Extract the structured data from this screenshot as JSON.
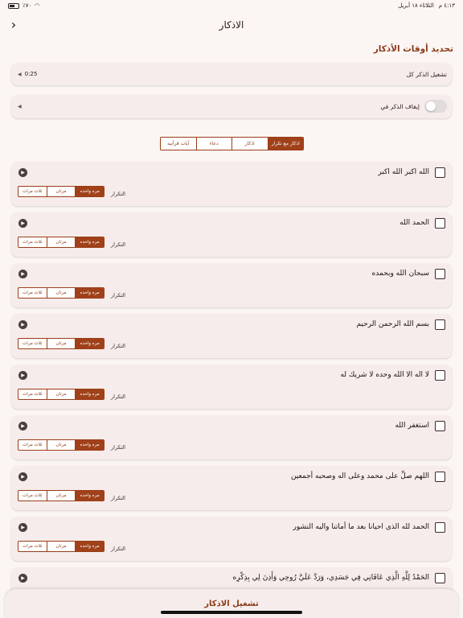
{
  "status": {
    "time": "٤:١٣ م",
    "date": "الثلاثاء ١٨ أبريل",
    "battery": "٪٧٠"
  },
  "nav": {
    "title": "الاذكار"
  },
  "settings": {
    "section_title": "تحديد أوقات الأذكار",
    "play_every_label": "تشغيل الذكر كل",
    "play_every_value": "0:25",
    "stop_label": "إيقاف الذكر في"
  },
  "tabs": [
    {
      "label": "اذكار مع تكرار",
      "active": true
    },
    {
      "label": "اذكار",
      "active": false
    },
    {
      "label": "دعاء",
      "active": false
    },
    {
      "label": "آيات قرآنيه",
      "active": false
    }
  ],
  "repeat_label": "التكرار",
  "repeat_options": [
    "مره واحده",
    "مرتان",
    "ثلاث مرات"
  ],
  "azkar": [
    {
      "text": "الله اكبر الله اكبر"
    },
    {
      "text": "الحمد الله"
    },
    {
      "text": "سبحان الله وبحمده"
    },
    {
      "text": "بسم الله الرحمن الرحيم"
    },
    {
      "text": "لا اله الا الله وحده لا شريك له"
    },
    {
      "text": "استغفر الله"
    },
    {
      "text": "اللهم صلِّ على محمد وعلى اله وصحبه أجمعين"
    },
    {
      "text": "الحمد لله الذى احيانا بعد ما أماتنا واليه النشور"
    },
    {
      "text": "الحَمْدُ لِلَّهِ الَّذِي عَافَانِي فِي جَسَدِي، وَرَدَّ عَلَيَّ رُوحِي وَأَذِنَ لِي بِذِكْرِه"
    }
  ],
  "bottom_button": "تشغيل الاذكار",
  "colors": {
    "accent": "#a0411a",
    "card_bg": "#f6eceb",
    "page_bg": "#fbf6f4"
  }
}
